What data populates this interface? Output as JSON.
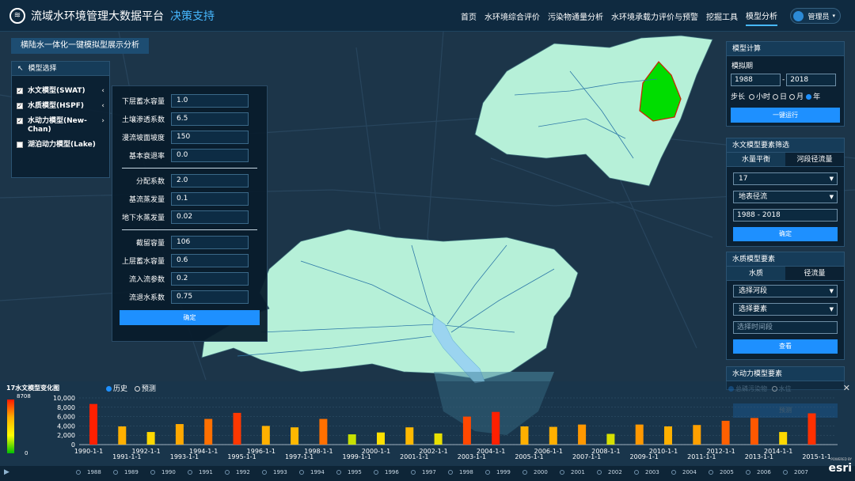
{
  "header": {
    "title": "流域水环境管理大数据平台",
    "subtitle": "决策支持",
    "nav": [
      "首页",
      "水环境综合评价",
      "污染物通量分析",
      "水环境承载力评价与预警",
      "挖掘工具",
      "模型分析"
    ],
    "active": 5,
    "user": "管理员"
  },
  "page_title": "横陆水一体化一键模拟型展示分析",
  "model_select": {
    "title": "模型选择",
    "items": [
      {
        "label": "水文模型(SWAT)",
        "checked": true
      },
      {
        "label": "水质模型(HSPF)",
        "checked": true
      },
      {
        "label": "水动力模型(New-Chan)",
        "checked": true
      },
      {
        "label": "湖泊动力模型(Lake)",
        "checked": false
      }
    ]
  },
  "params": {
    "group1": [
      {
        "label": "下层蓄水容量",
        "value": "1.0"
      },
      {
        "label": "土壤渗透系数",
        "value": "6.5"
      },
      {
        "label": "漫流坡面坡度",
        "value": "150"
      },
      {
        "label": "基本衰退率",
        "value": "0.0"
      }
    ],
    "group2": [
      {
        "label": "分配系数",
        "value": "2.0"
      },
      {
        "label": "基流蒸发量",
        "value": "0.1"
      },
      {
        "label": "地下水蒸发量",
        "value": "0.02"
      }
    ],
    "group3": [
      {
        "label": "截留容量",
        "value": "106"
      },
      {
        "label": "上层蓄水容量",
        "value": "0.6"
      },
      {
        "label": "流入流参数",
        "value": "0.2"
      },
      {
        "label": "流退水系数",
        "value": "0.75"
      }
    ],
    "confirm": "确定"
  },
  "calc": {
    "title": "模型计算",
    "period": "模拟期",
    "start": "1988",
    "end": "2018",
    "dash": "-",
    "step": "步长",
    "steps": [
      "小时",
      "日",
      "月",
      "年"
    ],
    "step_selected": 3,
    "run": "一键运行"
  },
  "hydro": {
    "title": "水文模型要素筛选",
    "tabs": [
      "水量平衡",
      "河段径流量"
    ],
    "select1": "17",
    "select2": "地表径流",
    "range": "1988 - 2018",
    "confirm": "确定"
  },
  "quality": {
    "title": "水质模型要素",
    "tabs": [
      "水质",
      "径流量"
    ],
    "select1": "选择河段",
    "select2": "选择要素",
    "placeholder": "选择时间段",
    "query": "查看"
  },
  "hydrodyn": {
    "title": "水动力模型要素",
    "radios": [
      "总磷污染物",
      "水位"
    ],
    "predict": "预测"
  },
  "chart_panel": {
    "title": "17水文模型变化图",
    "radios": [
      "历史",
      "预测"
    ],
    "radio_selected": 0,
    "legend_max": "8708",
    "legend_min": "0"
  },
  "chart_data": {
    "type": "bar",
    "categories": [
      "1990-1-1",
      "1991-1-1",
      "1992-1-1",
      "1993-1-1",
      "1994-1-1",
      "1995-1-1",
      "1996-1-1",
      "1997-1-1",
      "1998-1-1",
      "1999-1-1",
      "2000-1-1",
      "2001-1-1",
      "2002-1-1",
      "2003-1-1",
      "2004-1-1",
      "2005-1-1",
      "2006-1-1",
      "2007-1-1",
      "2008-1-1",
      "2009-1-1",
      "2010-1-1",
      "2011-1-1",
      "2012-1-1",
      "2013-1-1",
      "2014-1-1",
      "2015-1-1"
    ],
    "values": [
      8700,
      3900,
      2700,
      4400,
      5500,
      6800,
      4000,
      3700,
      5500,
      2200,
      2600,
      3700,
      2400,
      6000,
      7000,
      3900,
      3800,
      4300,
      2300,
      4300,
      3900,
      4200,
      5100,
      5700,
      2700,
      6700
    ],
    "colors": [
      "#ff2000",
      "#ffb000",
      "#ffd800",
      "#ffa800",
      "#ff7000",
      "#ff3800",
      "#ffb000",
      "#ffb800",
      "#ff7000",
      "#c8e000",
      "#ffe000",
      "#ffb800",
      "#e8e000",
      "#ff4800",
      "#ff2000",
      "#ffb000",
      "#ffb000",
      "#ff9800",
      "#d8e000",
      "#ff9800",
      "#ffb000",
      "#ffa000",
      "#ff6000",
      "#ff5800",
      "#ffd800",
      "#ff3000"
    ],
    "ylim": [
      0,
      10000
    ],
    "yticks": [
      "0",
      "2,000",
      "4,000",
      "6,000",
      "8,000",
      "10,000"
    ]
  },
  "timeline": [
    "1988",
    "1989",
    "1990",
    "1991",
    "1992",
    "1993",
    "1994",
    "1995",
    "1996",
    "1997",
    "1998",
    "1999",
    "2000",
    "2001",
    "2002",
    "2003",
    "2004",
    "2005",
    "2006",
    "2007"
  ],
  "esri": {
    "powered": "POWERED BY",
    "brand": "esri"
  }
}
